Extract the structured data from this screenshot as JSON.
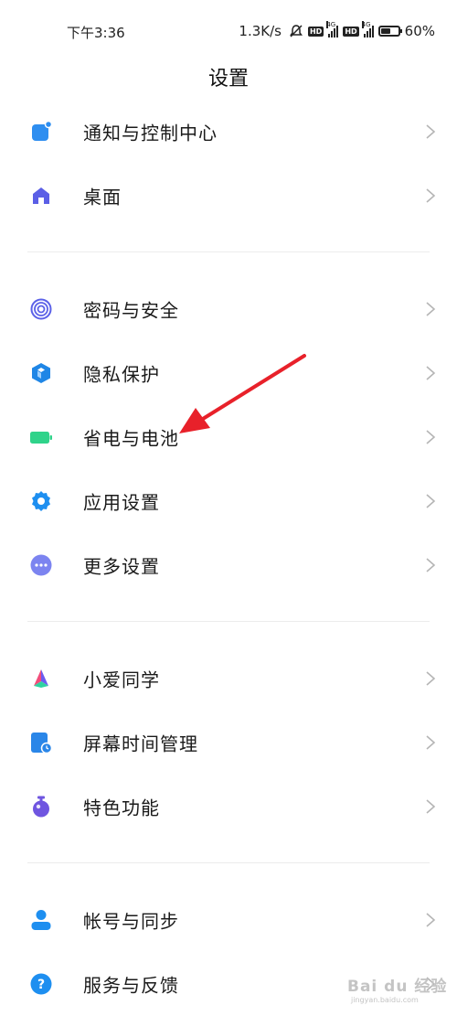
{
  "status_bar": {
    "time": "下午3:36",
    "network_speed": "1.3K/s",
    "hd_label": "HD",
    "network_type": "4G",
    "battery_percent": "60%",
    "battery_level": 0.6
  },
  "header": {
    "title": "设置"
  },
  "groups": [
    {
      "items": [
        {
          "label": "通知与控制中心",
          "icon": "notification-icon",
          "color": "#2e8ef0"
        },
        {
          "label": "桌面",
          "icon": "home-icon",
          "color": "#5b5fe6"
        }
      ]
    },
    {
      "items": [
        {
          "label": "密码与安全",
          "icon": "fingerprint-icon",
          "color": "#5b61e8"
        },
        {
          "label": "隐私保护",
          "icon": "privacy-icon",
          "color": "#1f86e6"
        },
        {
          "label": "省电与电池",
          "icon": "battery-icon",
          "color": "#2fd38a"
        },
        {
          "label": "应用设置",
          "icon": "gear-icon",
          "color": "#1e8ff0"
        },
        {
          "label": "更多设置",
          "icon": "more-icon",
          "color": "#7c84f0"
        }
      ]
    },
    {
      "items": [
        {
          "label": "小爱同学",
          "icon": "xiaoai-icon",
          "color": "#6b5cf0"
        },
        {
          "label": "屏幕时间管理",
          "icon": "screen-time-icon",
          "color": "#2a86e8"
        },
        {
          "label": "特色功能",
          "icon": "feature-icon",
          "color": "#6f55e0"
        }
      ]
    },
    {
      "items": [
        {
          "label": "帐号与同步",
          "icon": "account-icon",
          "color": "#1e8ff0"
        },
        {
          "label": "服务与反馈",
          "icon": "help-icon",
          "color": "#1e8ff0"
        }
      ]
    }
  ],
  "annotation": {
    "arrow_color": "#e8212a"
  },
  "watermark": {
    "main": "Bai du 经验",
    "sub": "jingyan.baidu.com"
  }
}
